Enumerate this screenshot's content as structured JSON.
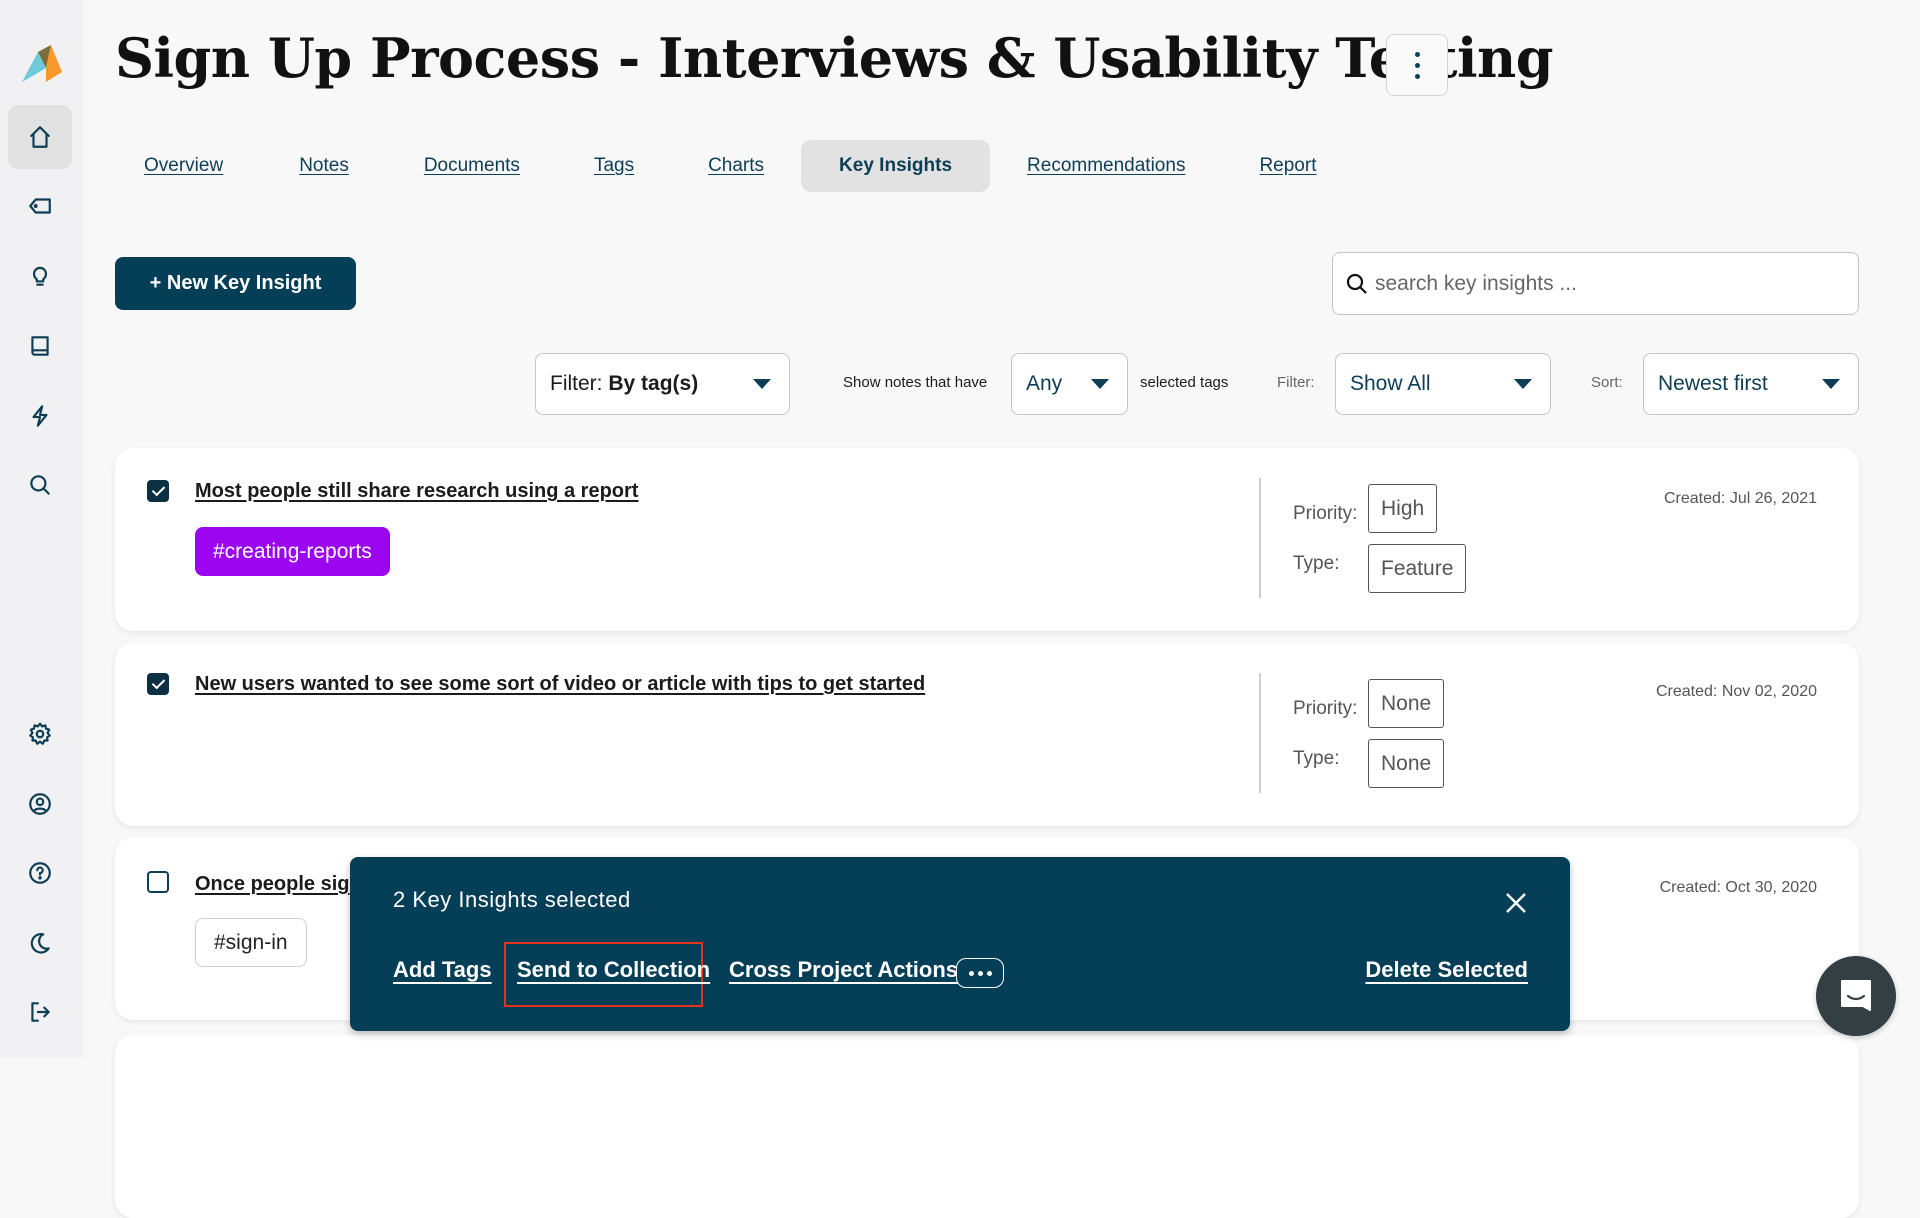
{
  "sidebar": {
    "top_items": [
      {
        "name": "home",
        "active": true
      },
      {
        "name": "tags",
        "active": false
      },
      {
        "name": "insights",
        "active": false
      },
      {
        "name": "library",
        "active": false
      },
      {
        "name": "actions",
        "active": false
      },
      {
        "name": "search",
        "active": false
      }
    ],
    "bottom_items": [
      "settings",
      "account",
      "help",
      "dark-mode",
      "logout"
    ]
  },
  "header": {
    "title": "Sign Up Process - Interviews & Usability Testing"
  },
  "tabs": [
    {
      "label": "Overview",
      "active": false
    },
    {
      "label": "Notes",
      "active": false
    },
    {
      "label": "Documents",
      "active": false
    },
    {
      "label": "Tags",
      "active": false
    },
    {
      "label": "Charts",
      "active": false
    },
    {
      "label": "Key Insights",
      "active": true
    },
    {
      "label": "Recommendations",
      "active": false
    },
    {
      "label": "Report",
      "active": false
    }
  ],
  "toolbar": {
    "new_button": "+ New Key Insight",
    "search_placeholder": "search key insights ...",
    "filter_prefix": "Filter: ",
    "filter_value": "By tag(s)",
    "show_notes_label": "Show notes that have",
    "any_value": "Any",
    "selected_tags_label": "selected tags",
    "filter_label": "Filter:",
    "show_value": "Show All",
    "sort_label": "Sort:",
    "sort_value": "Newest first"
  },
  "insights": [
    {
      "title": "Most people still share research using a report",
      "checked": true,
      "tag": "#creating-reports",
      "tag_color": "#9b05f0",
      "priority_label": "Priority:",
      "priority": "High",
      "type_label": "Type:",
      "type": "Feature",
      "created": "Created: Jul 26, 2021"
    },
    {
      "title": "New users wanted to see some sort of video or article with tips to get started",
      "checked": true,
      "tag": null,
      "priority_label": "Priority:",
      "priority": "None",
      "type_label": "Type:",
      "type": "None",
      "created": "Created: Nov 02, 2020"
    },
    {
      "title": "Once people sig",
      "checked": false,
      "tag": "#sign-in",
      "created": "Created: Oct 30, 2020"
    }
  ],
  "bulk_bar": {
    "count_text": "2 Key Insights selected",
    "actions": {
      "add_tags": "Add Tags",
      "send_to_collection": "Send to Collection",
      "cross_project": "Cross Project Actions",
      "delete": "Delete Selected"
    },
    "highlight_color": "#e5331b"
  },
  "colors": {
    "primary": "#053f57",
    "accent_text": "#0d3e55",
    "sidebar_bg": "#f1f1f3",
    "page_bg": "#f8f8f8"
  }
}
